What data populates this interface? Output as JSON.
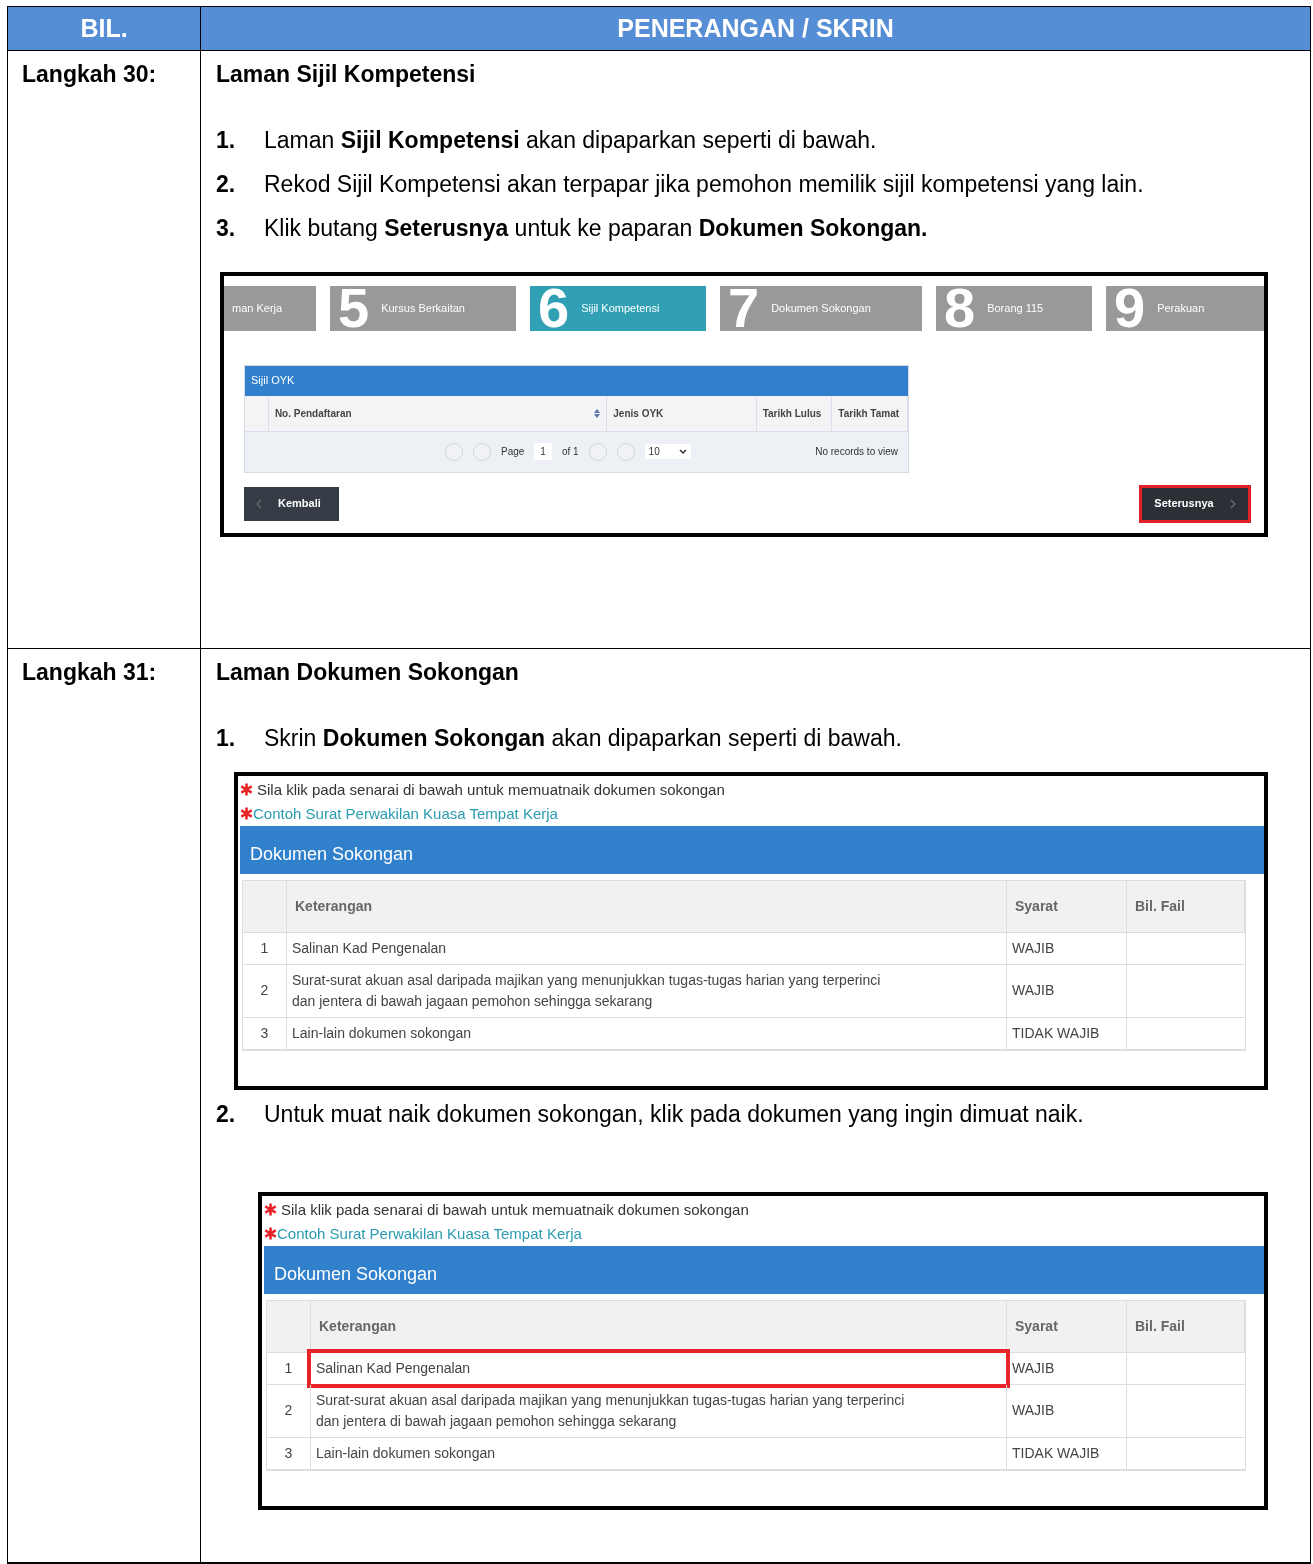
{
  "header": {
    "columns": [
      "BIL.",
      "PENERANGAN / SKRIN"
    ]
  },
  "steps": [
    {
      "label": "Langkah 30:",
      "title": "Laman Sijil Kompetensi",
      "content": [
        {
          "kind": "item",
          "num": "1.",
          "text": "Laman **Sijil Kompetensi** akan dipaparkan seperti di bawah."
        },
        {
          "kind": "item",
          "num": "2.",
          "text": "Rekod Sijil Kompetensi akan terpapar jika pemohon memilik sijil kompetensi yang lain."
        },
        {
          "kind": "item",
          "num": "3.",
          "text": "Klik butang **Seterusnya** untuk ke paparan **Dokumen Sokongan.**"
        },
        {
          "kind": "wizard",
          "tabs": [
            {
              "label": "man Kerja",
              "selected": false
            },
            {
              "number": "5",
              "label": "Kursus Berkaitan",
              "selected": false
            },
            {
              "number": "6",
              "label": "Sijil Kompetensi",
              "selected": true
            },
            {
              "number": "7",
              "label": "Dokumen Sokongan",
              "selected": false
            },
            {
              "number": "8",
              "label": "Borang 115",
              "selected": false
            },
            {
              "number": "9",
              "label": "Perakuan",
              "selected": false
            }
          ],
          "panel_title": "Sijil OYK",
          "columns": [
            "No. Pendaftaran",
            "Jenis OYK",
            "Tarikh Lulus",
            "Tarikh Tamat"
          ],
          "pager": {
            "page_label": "Page",
            "page": "1",
            "of": "of 1",
            "page_size": "10",
            "records": "No records to view"
          },
          "back_button": {
            "label": "Kembali"
          },
          "next_button": {
            "label": "Seterusnya",
            "highlighted": true
          }
        }
      ]
    },
    {
      "label": "Langkah 31:",
      "title": "Laman Dokumen Sokongan",
      "content": [
        {
          "kind": "item",
          "num": "1.",
          "text": "Skrin **Dokumen Sokongan** akan dipaparkan seperti di bawah."
        },
        {
          "kind": "documents",
          "note": "Sila klik pada senarai di bawah untuk memuatnaik dokumen sokongan",
          "link": "Contoh Surat Perwakilan Kuasa Tempat Kerja",
          "panel_title": "Dokumen Sokongan",
          "columns": [
            "Keterangan",
            "Syarat",
            "Bil. Fail"
          ],
          "rows": [
            {
              "no": "1",
              "description": "Salinan Kad Pengenalan",
              "requirement": "WAJIB",
              "highlighted": false
            },
            {
              "no": "2",
              "description": "Surat-surat akuan asal daripada majikan yang menunjukkan tugas-tugas harian yang terperinci dan jentera di bawah jagaan pemohon sehingga sekarang",
              "requirement": "WAJIB",
              "highlighted": false
            },
            {
              "no": "3",
              "description": "Lain-lain dokumen sokongan",
              "requirement": "TIDAK WAJIB",
              "highlighted": false
            }
          ]
        },
        {
          "kind": "item",
          "num": "2.",
          "text": "Untuk muat naik dokumen sokongan, klik pada dokumen yang ingin dimuat naik."
        },
        {
          "kind": "documents",
          "note": "Sila klik pada senarai di bawah untuk memuatnaik dokumen sokongan",
          "link": "Contoh Surat Perwakilan Kuasa Tempat Kerja",
          "panel_title": "Dokumen Sokongan",
          "columns": [
            "Keterangan",
            "Syarat",
            "Bil. Fail"
          ],
          "rows": [
            {
              "no": "1",
              "description": "Salinan Kad Pengenalan",
              "requirement": "WAJIB",
              "highlighted": true
            },
            {
              "no": "2",
              "description": "Surat-surat akuan asal daripada majikan yang menunjukkan tugas-tugas harian yang terperinci dan jentera di bawah jagaan pemohon sehingga sekarang",
              "requirement": "WAJIB",
              "highlighted": false
            },
            {
              "no": "3",
              "description": "Lain-lain dokumen sokongan",
              "requirement": "TIDAK WAJIB",
              "highlighted": false
            }
          ]
        }
      ]
    }
  ]
}
